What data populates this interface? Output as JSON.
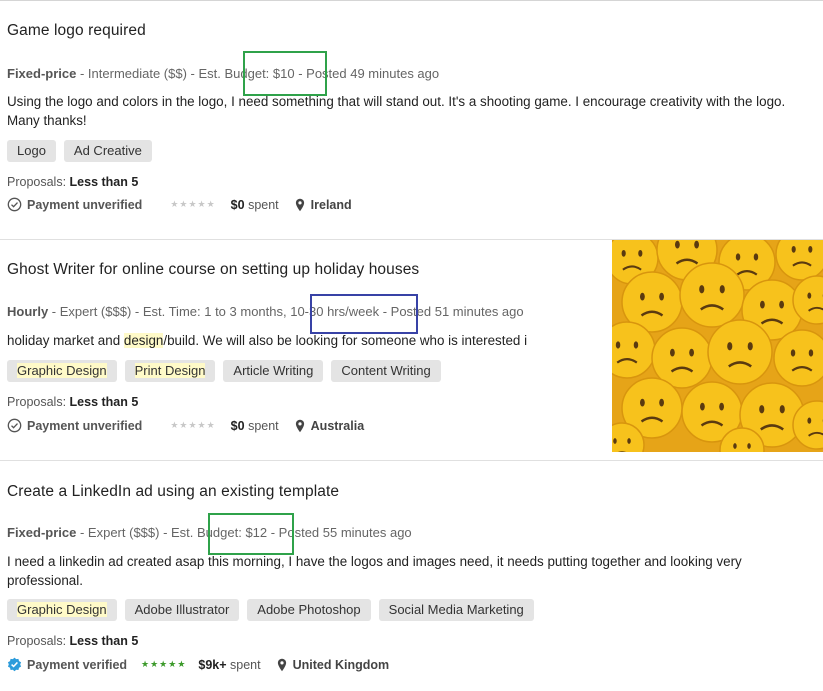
{
  "jobs": [
    {
      "title": "Game logo required",
      "type": "Fixed-price",
      "meta_rest": "- Intermediate ($$) - Est. Budget: $10 - Posted 49 minutes ago",
      "description": "Using the logo and colors in the logo, I need something that will stand out. It's a shooting game. I encourage creativity with the logo. Many thanks!",
      "tags": [
        "Logo",
        "Ad Creative"
      ],
      "proposals_label": "Proposals:",
      "proposals_value": "Less than 5",
      "payment": "Payment unverified",
      "rating": 0,
      "spent_amount": "$0",
      "spent_label": "spent",
      "location": "Ireland"
    },
    {
      "title": "Ghost Writer for online course on setting up holiday houses",
      "type": "Hourly",
      "meta_rest": "- Expert ($$$) - Est. Time: 1 to 3 months, 10-30 hrs/week - Posted 51 minutes ago",
      "desc_before": "holiday market and ",
      "desc_highlight": "design",
      "desc_after": "/build. We will also be looking for someone who is interested i",
      "tags": [
        "Graphic Design",
        "Print Design",
        "Article Writing",
        "Content Writing"
      ],
      "proposals_label": "Proposals:",
      "proposals_value": "Less than 5",
      "payment": "Payment unverified",
      "rating": 0,
      "spent_amount": "$0",
      "spent_label": "spent",
      "location": "Australia"
    },
    {
      "title": "Create a LinkedIn ad using an existing template",
      "type": "Fixed-price",
      "meta_rest": "- Expert ($$$) - Est. Budget: $12 - Posted 55 minutes ago",
      "description": "I need a linkedin ad created asap this morning, I have the logos and images need, it needs putting together and looking very professional.",
      "tags": [
        "Graphic Design",
        "Adobe Illustrator",
        "Adobe Photoshop",
        "Social Media Marketing"
      ],
      "proposals_label": "Proposals:",
      "proposals_value": "Less than 5",
      "payment": "Payment verified",
      "rating": 5,
      "spent_amount": "$9k+",
      "spent_label": "spent",
      "location": "United Kingdom"
    }
  ],
  "stars_empty": "★★★★★",
  "stars_full": "★★★★★",
  "colors": {
    "annotation_green": "#2fa24a",
    "annotation_blue": "#3842a6",
    "verified_blue": "#2d9cdb",
    "stars_green": "#3c9a2a",
    "emoji_yellow": "#f7c21c"
  },
  "thumbnail_icon": "sad-face-emoji-icon"
}
